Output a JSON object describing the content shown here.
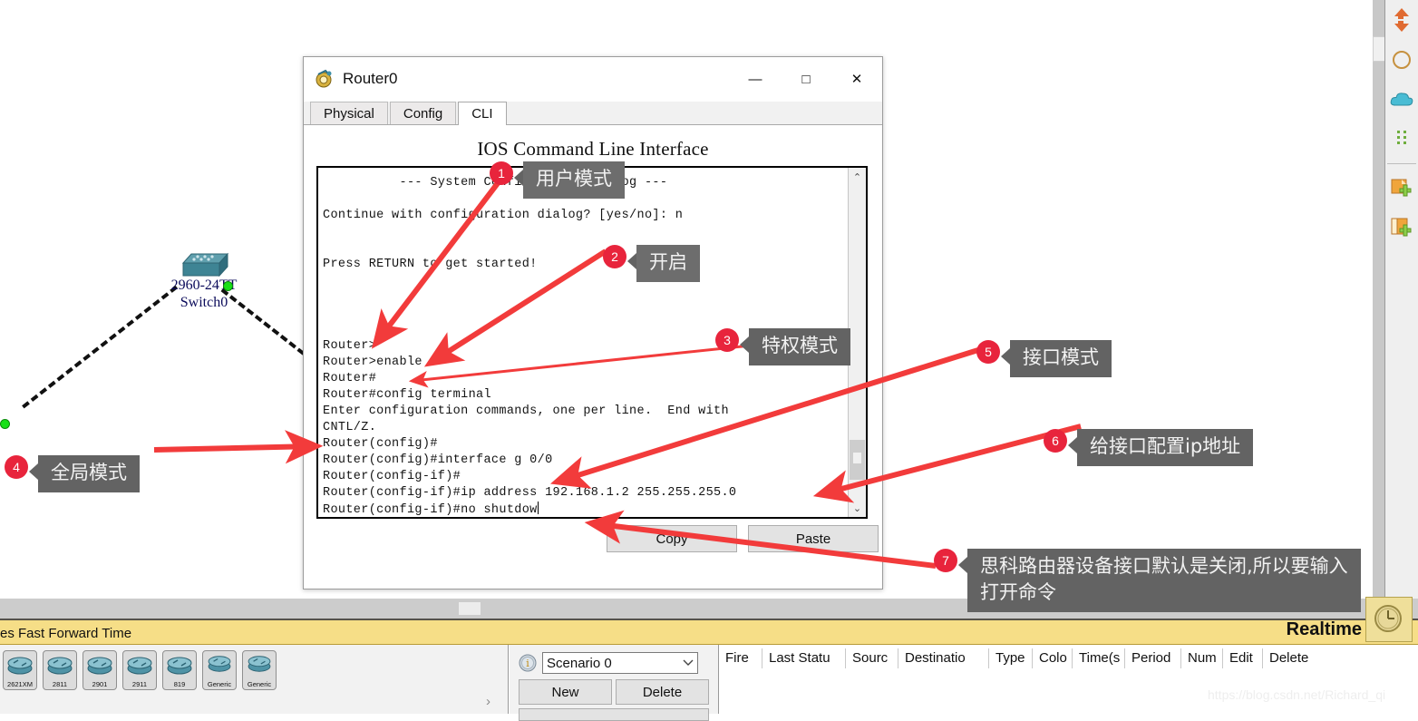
{
  "topology": {
    "switch": {
      "model": "2960-24TT",
      "name": "Switch0",
      "icon": "switch-icon"
    }
  },
  "dialog": {
    "title": "Router0",
    "icon": "packet-tracer-router-icon",
    "window_controls": {
      "minimize": "—",
      "maximize": "□",
      "close": "✕"
    },
    "tabs": [
      {
        "label": "Physical",
        "active": false
      },
      {
        "label": "Config",
        "active": false
      },
      {
        "label": "CLI",
        "active": true
      }
    ],
    "cli_heading": "IOS Command Line Interface",
    "terminal_text": "          --- System Configuration Dialog ---\n\nContinue with configuration dialog? [yes/no]: n\n\n\nPress RETURN to get started!\n\n\n\n\nRouter>\nRouter>enable\nRouter#\nRouter#config terminal\nEnter configuration commands, one per line.  End with\nCNTL/Z.\nRouter(config)#\nRouter(config)#interface g 0/0\nRouter(config-if)#\nRouter(config-if)#ip address 192.168.1.2 255.255.255.0\nRouter(config-if)#no shutdow",
    "buttons": {
      "copy": "Copy",
      "paste": "Paste"
    },
    "scrollbar": {
      "up": "⌃",
      "down": "⌄"
    }
  },
  "annotations": [
    {
      "num": "1",
      "text": "用户模式"
    },
    {
      "num": "2",
      "text": "开启"
    },
    {
      "num": "3",
      "text": "特权模式"
    },
    {
      "num": "4",
      "text": "全局模式"
    },
    {
      "num": "5",
      "text": "接口模式"
    },
    {
      "num": "6",
      "text": "给接口配置ip地址"
    },
    {
      "num": "7",
      "text": "思科路由器设备接口默认是关闭,所以要输入\n打开命令"
    }
  ],
  "bottom": {
    "yellow_bar_text": "es  Fast Forward Time",
    "realtime_label": "Realtime",
    "clock_icon": "clock-icon",
    "devices": [
      {
        "label": "2621XM"
      },
      {
        "label": "2811"
      },
      {
        "label": "2901"
      },
      {
        "label": "2911"
      },
      {
        "label": "819"
      },
      {
        "label": "Generic"
      },
      {
        "label": "Generic"
      }
    ],
    "device_next_arrow": "›",
    "scenario": {
      "info_icon": "info-icon",
      "selected": "Scenario 0",
      "dropdown_icon": "chevron-down-icon",
      "new_label": "New",
      "delete_label": "Delete"
    },
    "event_table_headers": [
      "Fire",
      "Last Statu",
      "Sourc",
      "Destinatio",
      "Type",
      "Colo",
      "Time(s",
      "Period",
      "Num",
      "Edit",
      "Delete"
    ]
  },
  "right_toolbar": {
    "items": [
      "arrow-icon",
      "circle-icon",
      "cloud-icon",
      "dots-icon",
      "add-note-icon",
      "add-file-icon"
    ]
  },
  "watermark": "https://blog.csdn.net/Richard_qi",
  "colors": {
    "accent_red": "#e8243c",
    "bubble_gray": "#636363",
    "yellow_bar": "#f6de87",
    "switch_blue": "#3e8494"
  }
}
